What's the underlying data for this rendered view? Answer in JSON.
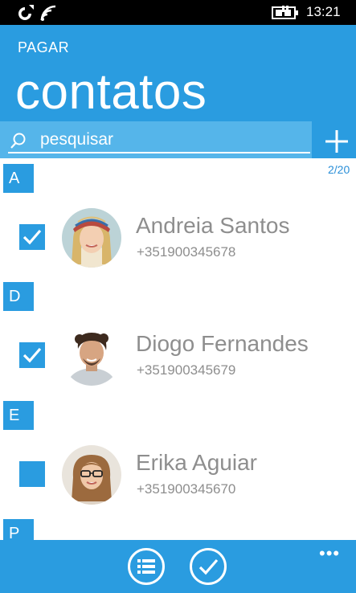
{
  "status": {
    "time": "13:21"
  },
  "header": {
    "app_label": "PAGAR",
    "page_title": "contatos"
  },
  "search": {
    "placeholder": "pesquisar"
  },
  "selection": {
    "count": "2/20"
  },
  "groups": [
    {
      "letter": "A",
      "contact": {
        "name": "Andreia Santos",
        "phone": "+351900345678",
        "checked": true
      }
    },
    {
      "letter": "D",
      "contact": {
        "name": "Diogo Fernandes",
        "phone": "+351900345679",
        "checked": true
      }
    },
    {
      "letter": "E",
      "contact": {
        "name": "Erika Aguiar",
        "phone": "+351900345670",
        "checked": false
      }
    },
    {
      "letter": "P"
    }
  ],
  "appbar": {
    "more": "•••"
  },
  "colors": {
    "accent": "#2a9ce0",
    "search_panel": "#55b5ea",
    "text_gray": "#8e8e8e"
  },
  "icons": [
    "signal-icon",
    "wifi-icon",
    "battery-charging-icon",
    "search-icon",
    "add-icon",
    "checkmark-icon",
    "list-icon",
    "accept-icon",
    "more-icon"
  ]
}
